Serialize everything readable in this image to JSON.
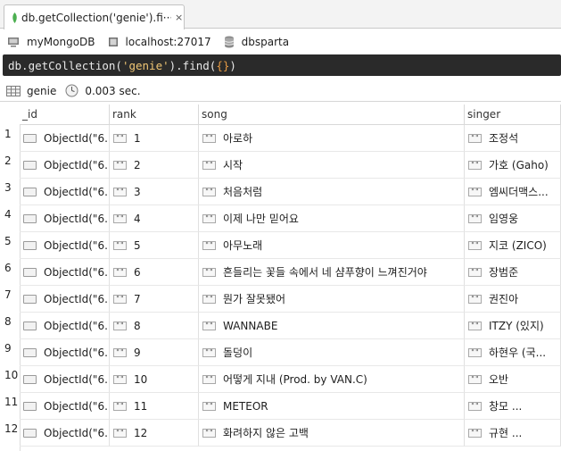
{
  "tab": {
    "title": "db.getCollection('genie').fi···",
    "close": "×"
  },
  "connection": {
    "name": "myMongoDB",
    "host": "localhost:27017",
    "database": "dbsparta"
  },
  "query": {
    "prefix": "db.getCollection(",
    "arg": "'genie'",
    "mid": ").find(",
    "braces": "{}",
    "suffix": ")"
  },
  "result": {
    "collection": "genie",
    "time": "0.003 sec."
  },
  "columns": [
    "_id",
    "rank",
    "song",
    "singer"
  ],
  "type_glyph": "\"\"",
  "rows": [
    {
      "n": "1",
      "id": "ObjectId(\"6...",
      "rank": "1",
      "song": "아로하",
      "singer": "조정석"
    },
    {
      "n": "2",
      "id": "ObjectId(\"6...",
      "rank": "2",
      "song": "시작",
      "singer": "가호 (Gaho)"
    },
    {
      "n": "3",
      "id": "ObjectId(\"6...",
      "rank": "3",
      "song": "처음처럼",
      "singer": "엠씨더맥스..."
    },
    {
      "n": "4",
      "id": "ObjectId(\"6...",
      "rank": "4",
      "song": "이제 나만 믿어요",
      "singer": "임영웅"
    },
    {
      "n": "5",
      "id": "ObjectId(\"6...",
      "rank": "5",
      "song": "아무노래",
      "singer": "지코 (ZICO)"
    },
    {
      "n": "6",
      "id": "ObjectId(\"6...",
      "rank": "6",
      "song": "흔들리는 꽃들 속에서 네 샴푸향이 느껴진거야",
      "singer": "장범준"
    },
    {
      "n": "7",
      "id": "ObjectId(\"6...",
      "rank": "7",
      "song": "뭔가 잘못됐어",
      "singer": "권진아"
    },
    {
      "n": "8",
      "id": "ObjectId(\"6...",
      "rank": "8",
      "song": "WANNABE",
      "singer": "ITZY (있지)"
    },
    {
      "n": "9",
      "id": "ObjectId(\"6...",
      "rank": "9",
      "song": "돌덩이",
      "singer": "하현우 (국..."
    },
    {
      "n": "10",
      "id": "ObjectId(\"6...",
      "rank": "10",
      "song": "어떻게 지내 (Prod. by VAN.C)",
      "singer": "오반"
    },
    {
      "n": "11",
      "id": "ObjectId(\"6...",
      "rank": "11",
      "song": "METEOR",
      "singer": "창모 ..."
    },
    {
      "n": "12",
      "id": "ObjectId(\"6...",
      "rank": "12",
      "song": "화려하지 않은 고백",
      "singer": "규현 ..."
    }
  ]
}
